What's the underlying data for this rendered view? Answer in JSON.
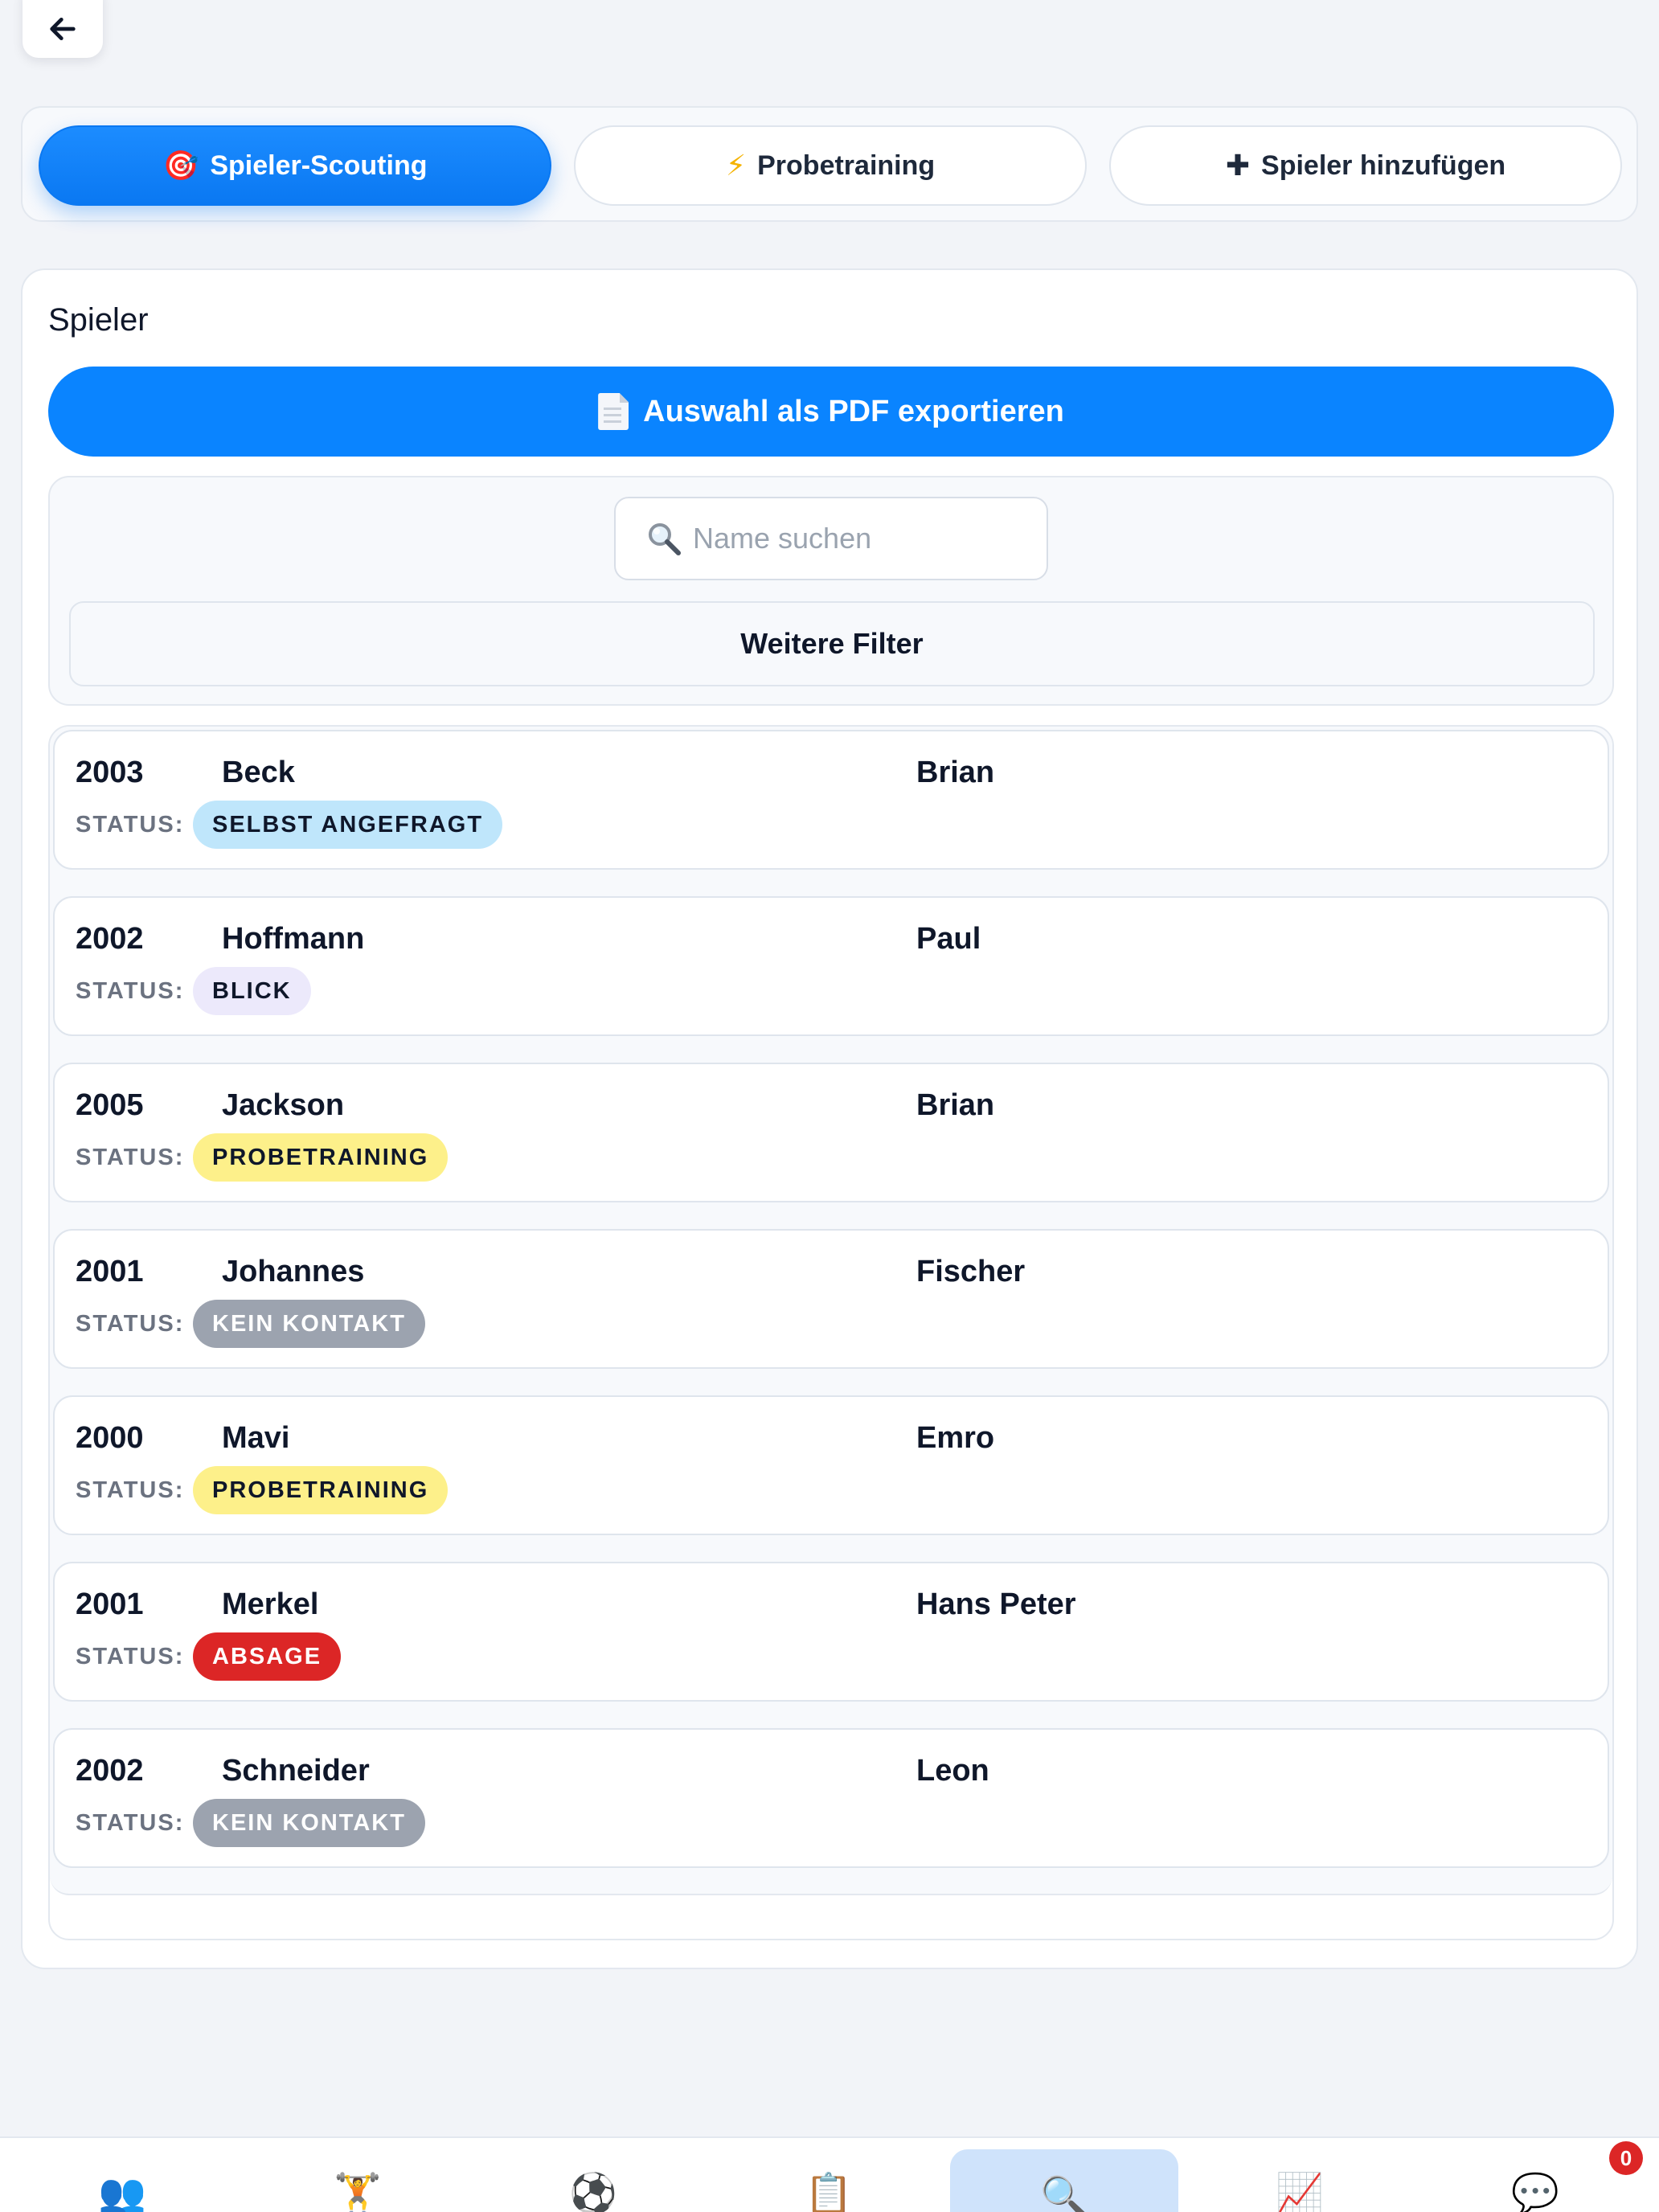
{
  "tabs": [
    {
      "icon": "🎯",
      "label": "Spieler-Scouting",
      "active": true
    },
    {
      "icon": "⚡",
      "label": "Probetraining",
      "active": false
    },
    {
      "icon": "✚",
      "label": "Spieler hinzufügen",
      "active": false
    }
  ],
  "section": {
    "title": "Spieler",
    "export_label": "Auswahl als PDF exportieren"
  },
  "filters": {
    "search_placeholder": "Name suchen",
    "more_filters_label": "Weitere Filter"
  },
  "status_label": "STATUS:",
  "players": [
    {
      "year": "2003",
      "last_name": "Beck",
      "first_name": "Brian",
      "status": "SELBST ANGEFRAGT",
      "status_color": "#bfe6fb"
    },
    {
      "year": "2002",
      "last_name": "Hoffmann",
      "first_name": "Paul",
      "status": "BLICK",
      "status_color": "#ece9fb"
    },
    {
      "year": "2005",
      "last_name": "Jackson",
      "first_name": "Brian",
      "status": "PROBETRAINING",
      "status_color": "#fdf08a"
    },
    {
      "year": "2001",
      "last_name": "Johannes",
      "first_name": "Fischer",
      "status": "KEIN KONTAKT",
      "status_color": "#9ca3af"
    },
    {
      "year": "2000",
      "last_name": "Mavi",
      "first_name": "Emro",
      "status": "PROBETRAINING",
      "status_color": "#fdf08a"
    },
    {
      "year": "2001",
      "last_name": "Merkel",
      "first_name": "Hans Peter",
      "status": "ABSAGE",
      "status_color": "#dc2626"
    },
    {
      "year": "2002",
      "last_name": "Schneider",
      "first_name": "Leon",
      "status": "KEIN KONTAKT",
      "status_color": "#9ca3af"
    }
  ],
  "bottom_nav": [
    {
      "icon": "👥",
      "name": "team-icon"
    },
    {
      "icon": "🏋️",
      "name": "training-icon"
    },
    {
      "icon": "⚽",
      "name": "soccer-ball-icon"
    },
    {
      "icon": "📋",
      "name": "clipboard-icon"
    },
    {
      "icon": "🔍",
      "name": "search-icon",
      "active": true
    },
    {
      "icon": "📈",
      "name": "chart-icon"
    },
    {
      "icon": "💬",
      "name": "chat-icon"
    }
  ],
  "chat_badge_count": "0",
  "colors": {
    "accent": "#0a84ff",
    "page_bg": "#f2f4f8"
  }
}
